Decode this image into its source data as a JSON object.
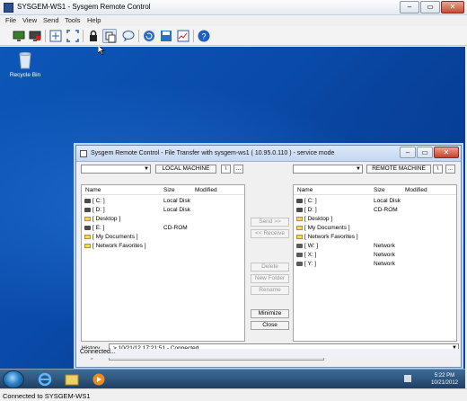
{
  "window": {
    "title": "SYSGEM-WS1 - Sysgem Remote Control",
    "minimize_glyph": "–",
    "maximize_glyph": "▭",
    "close_glyph": "✕"
  },
  "menu": [
    "File",
    "View",
    "Send",
    "Tools",
    "Help"
  ],
  "toolbar": {
    "icons": [
      "monitor-green-icon",
      "monitor-red-icon",
      "fit-window-icon",
      "fullscreen-icon",
      "lock-icon",
      "file-transfer-icon",
      "chat-icon",
      "refresh-icon",
      "disk-icon",
      "graph-icon",
      "help-icon"
    ]
  },
  "desktop": {
    "recycle_bin_label": "Recycle Bin"
  },
  "file_transfer": {
    "title": "Sysgem Remote Control - File Transfer with sysgem-ws1 ( 10.95.0.110 ) - service mode",
    "local": {
      "label": "LOCAL MACHINE",
      "path_button": "\\",
      "browse_button": "...",
      "columns": [
        "Name",
        "Size",
        "Modified"
      ],
      "rows": [
        {
          "icon": "drive-icon",
          "name": "[ C: ]",
          "size": "Local Disk"
        },
        {
          "icon": "drive-icon",
          "name": "[ D: ]",
          "size": "Local Disk"
        },
        {
          "icon": "folder-icon",
          "name": "[ Desktop ]",
          "size": ""
        },
        {
          "icon": "drive-icon",
          "name": "[ E: ]",
          "size": "CD-ROM"
        },
        {
          "icon": "folder-icon",
          "name": "[ My Documents ]",
          "size": ""
        },
        {
          "icon": "folder-icon",
          "name": "[ Network Favorites ]",
          "size": ""
        }
      ]
    },
    "remote": {
      "label": "REMOTE MACHINE",
      "path_button": "\\",
      "browse_button": "...",
      "columns": [
        "Name",
        "Size",
        "Modified"
      ],
      "rows": [
        {
          "icon": "drive-icon",
          "name": "[ C: ]",
          "size": "Local Disk"
        },
        {
          "icon": "drive-icon",
          "name": "[ D: ]",
          "size": "CD-ROM"
        },
        {
          "icon": "folder-icon",
          "name": "[ Desktop ]",
          "size": ""
        },
        {
          "icon": "folder-icon",
          "name": "[ My Documents ]",
          "size": ""
        },
        {
          "icon": "folder-icon",
          "name": "[ Network Favorites ]",
          "size": ""
        },
        {
          "icon": "net-drive-icon",
          "name": "[ W: ]",
          "size": "Network"
        },
        {
          "icon": "net-drive-icon",
          "name": "[ X: ]",
          "size": "Network"
        },
        {
          "icon": "net-drive-icon",
          "name": "[ Y: ]",
          "size": "Network"
        }
      ]
    },
    "buttons": {
      "send": "Send >>",
      "receive": "<< Receive",
      "delete": "Delete",
      "new_folder": "New Folder",
      "rename": "Rename",
      "minimize": "Minimize",
      "close": "Close"
    },
    "history_label": "History",
    "history_value": "> 10/21/12 17:21:51 -  Connected...",
    "progress_label": "Progress",
    "status": "Connected..."
  },
  "taskbar": {
    "time": "5:22 PM",
    "date": "10/21/2012"
  },
  "statusbar": "Connected to SYSGEM-WS1"
}
